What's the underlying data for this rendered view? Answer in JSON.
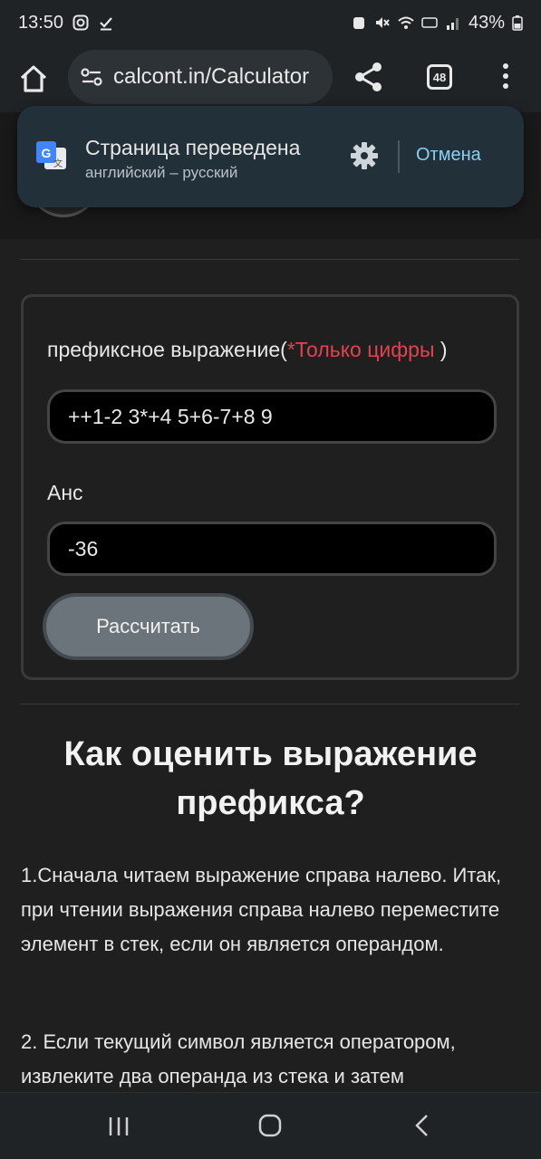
{
  "status_bar": {
    "time": "13:50",
    "battery": "43%"
  },
  "browser": {
    "url": "calcont.in/Calculator",
    "tab_count": "48"
  },
  "translate_popup": {
    "title": "Страница переведена",
    "subtitle": "английский – русский",
    "cancel_label": "Отмена"
  },
  "calculator": {
    "prefix_label": "префиксное выражение(",
    "prefix_hint": "*Только цифры",
    "prefix_label_end": " )",
    "expression_value": "++1-2 3*+4 5+6-7+8 9",
    "answer_label": "Анс",
    "answer_value": "-36",
    "calculate_label": "Рассчитать"
  },
  "article": {
    "heading": "Как оценить выражение префикса?",
    "paragraph_1": "1.Сначала читаем выражение справа налево. Итак, при чтении выражения справа налево переместите элемент в стек, если он является операндом.",
    "paragraph_2": "2. Если текущий символ является оператором, извлеките два операнда из стека и затем"
  },
  "colors": {
    "accent_hint": "#e0444f",
    "link_blue": "#8ccff2",
    "button_gray": "#6b747b"
  }
}
